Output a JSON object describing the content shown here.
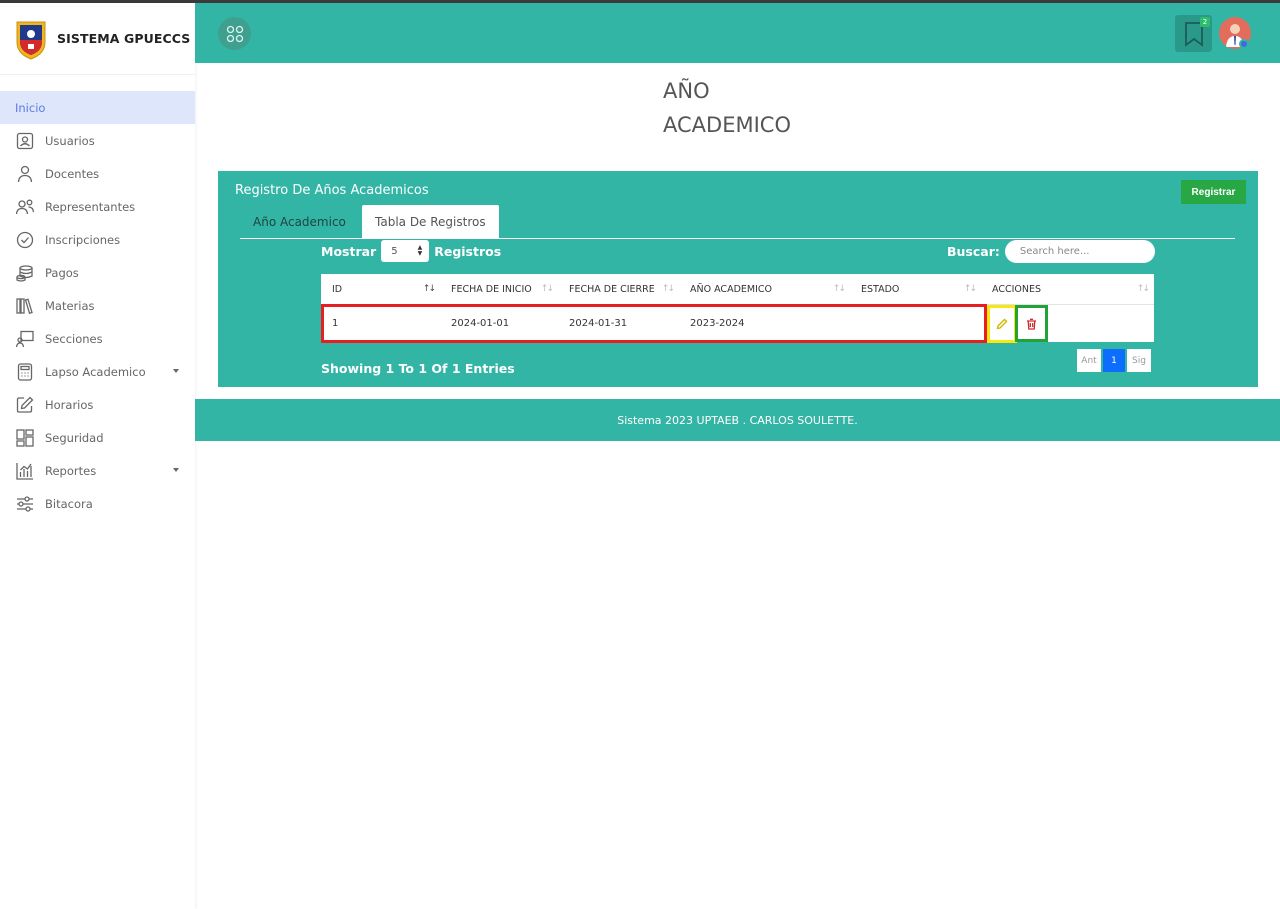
{
  "brand": {
    "name": "SISTEMA GPUECCS"
  },
  "sidebar": {
    "items": [
      {
        "label": "Inicio",
        "icon": "home-icon"
      },
      {
        "label": "Usuarios",
        "icon": "user-badge-icon"
      },
      {
        "label": "Docentes",
        "icon": "person-icon"
      },
      {
        "label": "Representantes",
        "icon": "people-icon"
      },
      {
        "label": "Inscripciones",
        "icon": "check-circle-icon"
      },
      {
        "label": "Pagos",
        "icon": "coins-icon"
      },
      {
        "label": "Materias",
        "icon": "books-icon"
      },
      {
        "label": "Secciones",
        "icon": "presentation-icon"
      },
      {
        "label": "Lapso Academico",
        "icon": "calculator-icon"
      },
      {
        "label": "Horarios",
        "icon": "edit-icon"
      },
      {
        "label": "Seguridad",
        "icon": "dashboard-icon"
      },
      {
        "label": "Reportes",
        "icon": "bar-chart-icon"
      },
      {
        "label": "Bitacora",
        "icon": "sliders-icon"
      }
    ]
  },
  "header": {
    "notifications": "2"
  },
  "page": {
    "title_line1": "AÑO",
    "title_line2": "ACADEMICO"
  },
  "card": {
    "title": "Registro De Años Academicos",
    "register_label": "Registrar",
    "tabs": [
      "Año Academico",
      "Tabla De Registros"
    ],
    "show_label": "Mostrar",
    "show_value": "5",
    "records_label": "Registros",
    "search_label": "Buscar:",
    "search_placeholder": "Search here...",
    "columns": [
      "ID",
      "FECHA DE INICIO",
      "FECHA DE CIERRE",
      "AÑO ACADEMICO",
      "ESTADO",
      "ACCIONES"
    ],
    "rows": [
      {
        "id": "1",
        "start": "2024-01-01",
        "end": "2024-01-31",
        "year": "2023-2024",
        "status": ""
      }
    ],
    "showing": "Showing 1 To 1 Of 1 Entries",
    "pager": {
      "prev": "Ant",
      "page": "1",
      "next": "Sig"
    }
  },
  "footer": {
    "text": "Sistema 2023 UPTAEB . CARLOS SOULETTE."
  }
}
